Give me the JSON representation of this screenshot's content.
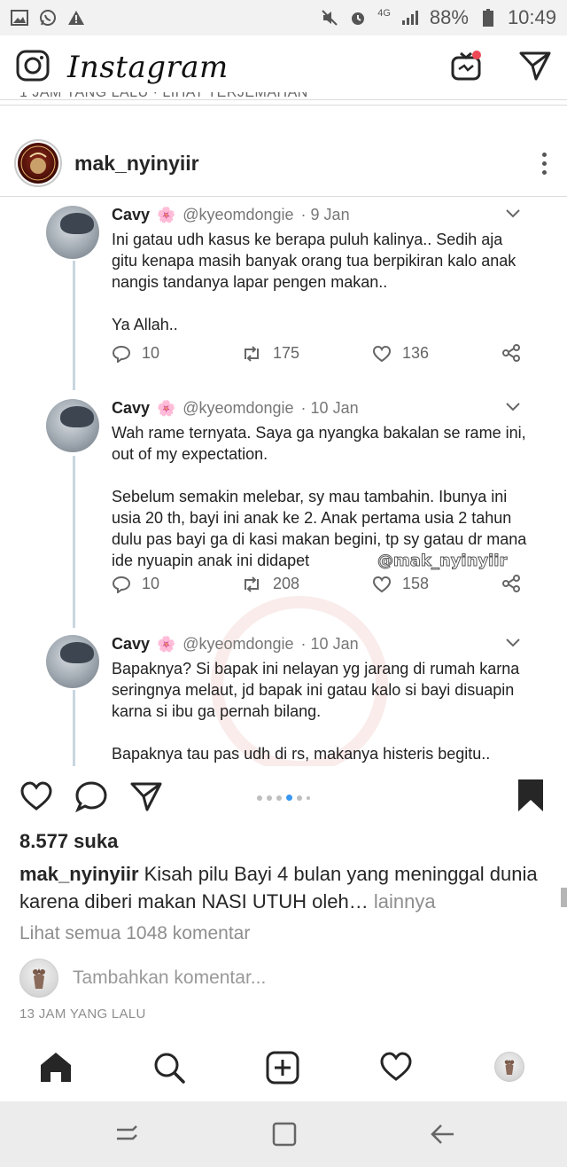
{
  "status_bar": {
    "battery": "88%",
    "time": "10:49",
    "network": "4G",
    "icons_left": [
      "image-icon",
      "whatsapp-icon",
      "warning-icon"
    ],
    "icons_right": [
      "mute-icon",
      "alarm-icon",
      "signal-icon",
      "battery-icon"
    ]
  },
  "app_header": {
    "logo_text": "Instagram",
    "icons": [
      "camera-icon",
      "igtv-icon",
      "direct-message-icon"
    ],
    "clipped_text": "1 JAM YANG LALU · LIHAT TERJEMAHAN"
  },
  "post": {
    "username": "mak_nyinyiir",
    "avatar_text": "Mak Nyinyiir",
    "tweets": [
      {
        "name": "Cavy",
        "flower": "🌸",
        "handle": "@kyeomdongie",
        "date": "· 9 Jan",
        "paragraphs": [
          "Ini gatau udh kasus ke berapa puluh kalinya.. Sedih aja gitu kenapa masih banyak orang tua berpikiran kalo anak nangis tandanya lapar pengen makan..",
          "Ya Allah.."
        ],
        "replies": "10",
        "retweets": "175",
        "likes": "136"
      },
      {
        "name": "Cavy",
        "flower": "🌸",
        "handle": "@kyeomdongie",
        "date": "· 10 Jan",
        "paragraphs": [
          "Wah rame ternyata. Saya ga nyangka bakalan se rame ini, out of my expectation.",
          "Sebelum semakin melebar, sy mau tambahin. Ibunya ini usia 20 th, bayi ini anak ke 2. Anak pertama usia 2 tahun dulu pas bayi ga di kasi makan begini, tp sy gatau dr mana ide nyuapin anak ini didapet"
        ],
        "replies": "10",
        "retweets": "208",
        "likes": "158"
      },
      {
        "name": "Cavy",
        "flower": "🌸",
        "handle": "@kyeomdongie",
        "date": "· 10 Jan",
        "paragraphs": [
          "Bapaknya? Si bapak ini nelayan yg jarang di rumah karna seringnya melaut, jd bapak ini gatau kalo si bayi disuapin karna si ibu ga pernah bilang.",
          "Bapaknya tau pas udh di rs, makanya histeris begitu.."
        ]
      }
    ],
    "image_watermark_tag": "@mak_nyinyiir",
    "carousel": {
      "count": 6,
      "active": 4
    },
    "likes_text": "8.577 suka",
    "caption_user": "mak_nyinyiir",
    "caption_text": " Kisah pilu Bayi 4 bulan yang meninggal dunia karena diberi makan NASI UTUH oleh…",
    "caption_more": " lainnya",
    "view_all_comments": "Lihat semua 1048 komentar",
    "add_comment_placeholder": "Tambahkan komentar...",
    "timestamp": "13 JAM YANG LALU"
  },
  "bottom_nav": {
    "items": [
      "home-icon",
      "search-icon",
      "add-post-icon",
      "activity-heart-icon",
      "profile-avatar"
    ]
  },
  "system_nav": {
    "items": [
      "recent-apps-icon",
      "home-button-icon",
      "back-icon"
    ]
  },
  "colors": {
    "accent_blue": "#3897f0",
    "text_primary": "#262626",
    "text_secondary": "#8e8e8e",
    "notification_red": "#ed4956"
  }
}
